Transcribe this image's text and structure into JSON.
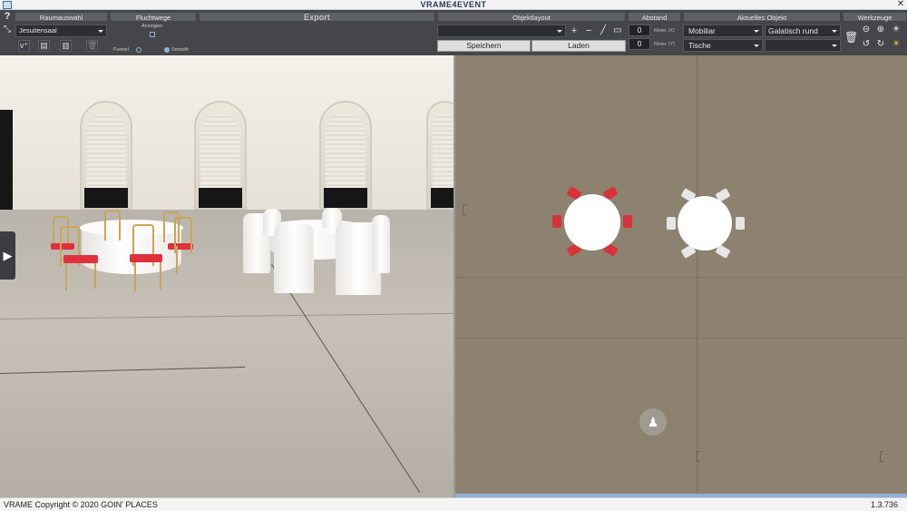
{
  "titlebar": {
    "logo": "VRAME4EVENT",
    "app_icon": "app-window-icon",
    "close_icon": "close-icon",
    "close_glyph": "✕"
  },
  "toolbar": {
    "help": "?",
    "raumauswahl": {
      "header": "Raumauswahl",
      "selected_room": "Jesuitensaal"
    },
    "fluchtwege": {
      "header": "Fluchtwege",
      "anzeigen": "Anzeigen",
      "funnel": "Funnel",
      "smooth": "Smooth"
    },
    "export": {
      "label": "Export"
    },
    "objektlayout": {
      "header": "Objektlayout",
      "speichern": "Speichern",
      "laden": "Laden"
    },
    "abstand": {
      "header": "Abstand",
      "x_value": "0",
      "y_value": "0",
      "x_unit": "Meter (X)",
      "y_unit": "Meter (Y)"
    },
    "aktuelles_objekt": {
      "header": "Aktuelles Objekt",
      "category": "Mobiliar",
      "subcategory": "Tische",
      "object": "Galatisch rund",
      "variant": ""
    },
    "werkzeuge": {
      "header": "Werkzeuge"
    }
  },
  "statusbar": {
    "copyright": "VRAME Copyright © 2020 GOIN' PLACES",
    "version": "1.3.736"
  },
  "colors": {
    "toolbar_bg": "#34363a",
    "header_bg": "#5d6064",
    "floor_2d": "#8d8170",
    "chair_red": "#e0303b",
    "chair_gold": "#c9a55a"
  }
}
